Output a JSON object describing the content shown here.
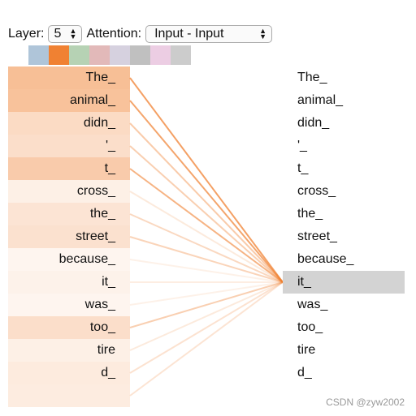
{
  "controls": {
    "layer_label": "Layer:",
    "layer_value": "5",
    "attention_label": "Attention:",
    "attention_value": "Input - Input"
  },
  "head_colors": [
    "#afc5d9",
    "#f08132",
    "#b6d2b4",
    "#e2b9b9",
    "#d6d1df",
    "#c0c0c0",
    "#eccde3",
    "#cccccc"
  ],
  "selected_head": 1,
  "accent": "#f08132",
  "highlight_color": "#d3d3d3",
  "left_tokens": [
    "The_",
    "animal_",
    "didn_",
    "'_",
    "t_",
    "cross_",
    "the_",
    "street_",
    "because_",
    "it_",
    "was_",
    "too_",
    "tire",
    "d_",
    ""
  ],
  "right_tokens": [
    "The_",
    "animal_",
    "didn_",
    "'_",
    "t_",
    "cross_",
    "the_",
    "street_",
    "because_",
    "it_",
    "was_",
    "too_",
    "tire",
    "d_"
  ],
  "selected_token": 9,
  "attention_weights": [
    0.9,
    0.85,
    0.45,
    0.4,
    0.7,
    0.12,
    0.3,
    0.35,
    0.04,
    0.08,
    0.04,
    0.4,
    0.12,
    0.2,
    0.18
  ],
  "watermark": "CSDN @zyw2002"
}
